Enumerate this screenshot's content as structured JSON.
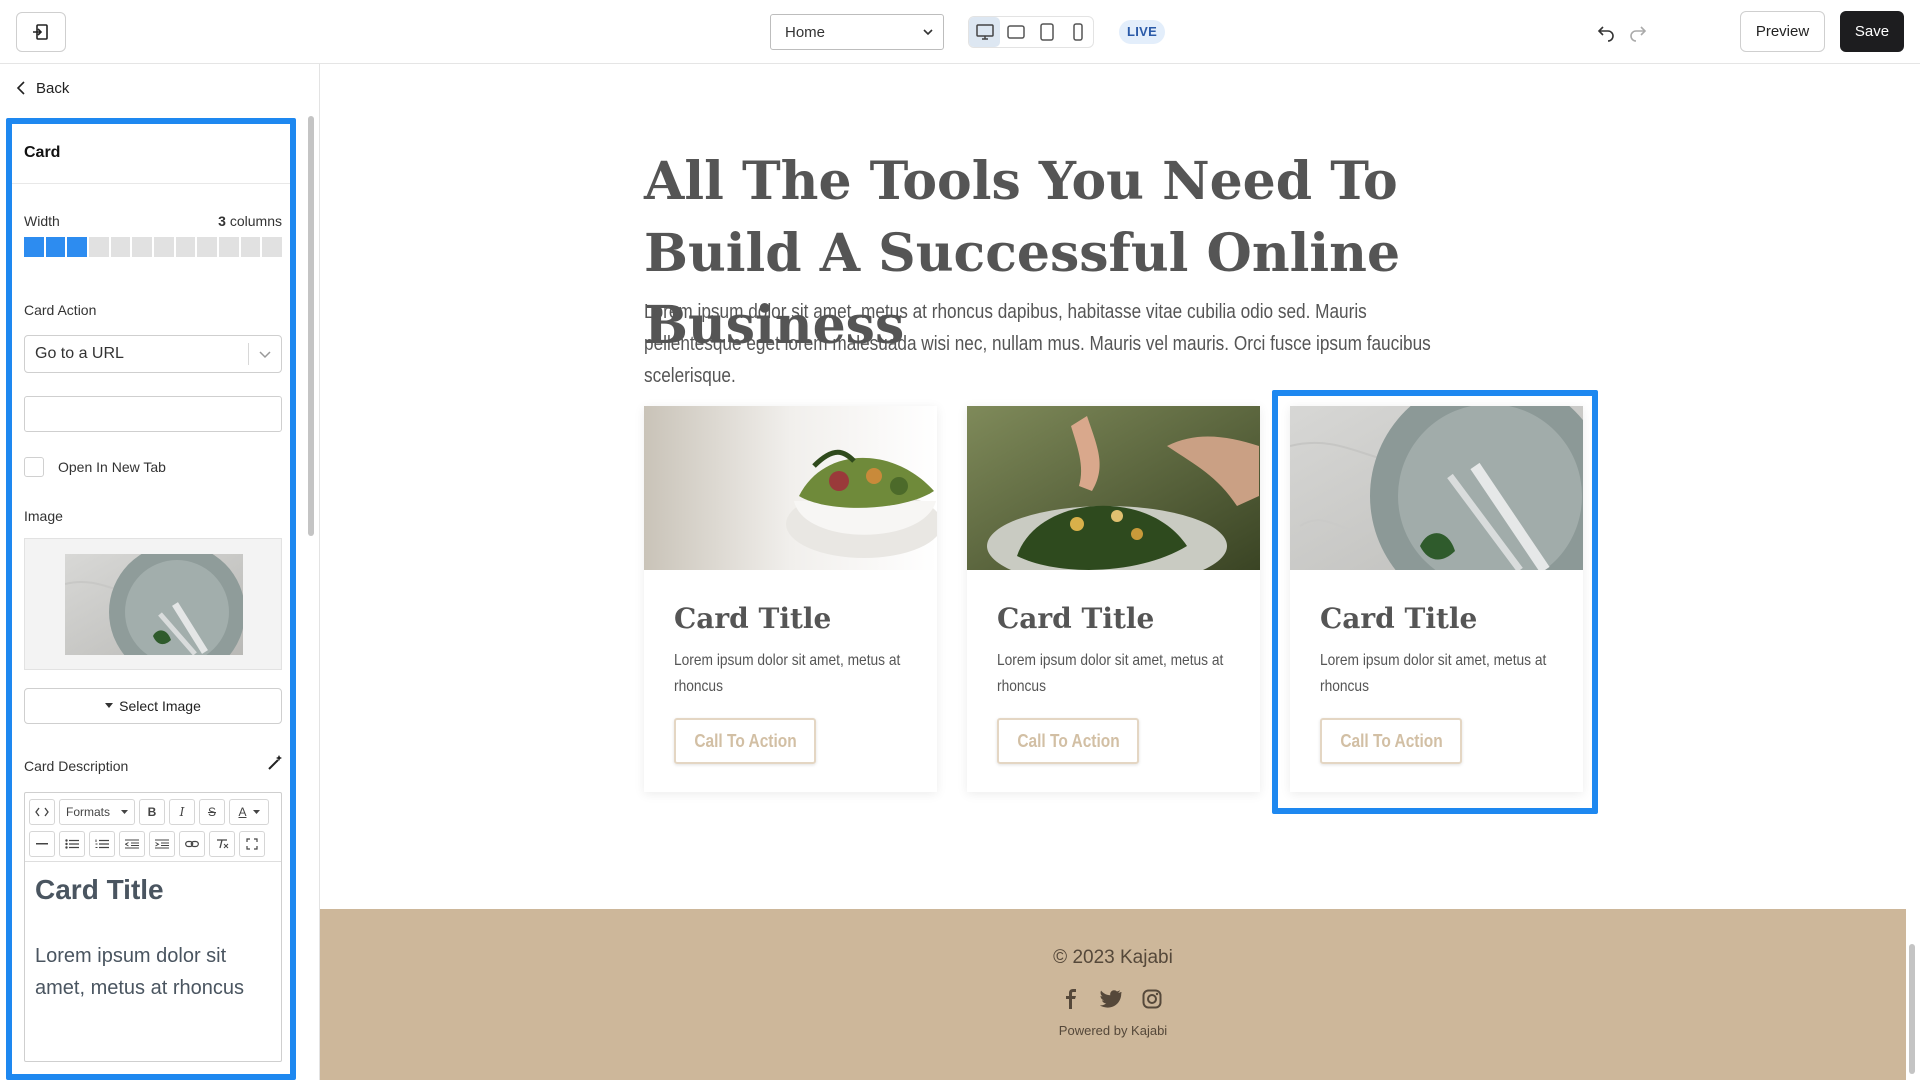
{
  "topbar": {
    "page_select_value": "Home",
    "live_badge": "LIVE",
    "preview_label": "Preview",
    "save_label": "Save"
  },
  "sidebar": {
    "back_label": "Back",
    "panel_title": "Card",
    "width_label": "Width",
    "width_value_number": "3",
    "width_value_unit": "columns",
    "width_columns_selected": 3,
    "width_columns_total": 12,
    "card_action_label": "Card Action",
    "card_action_value": "Go to a URL",
    "url_value": "",
    "open_new_tab_label": "Open In New Tab",
    "open_new_tab_checked": false,
    "image_label": "Image",
    "select_image_label": "Select Image",
    "card_description_label": "Card Description",
    "editor": {
      "formats_label": "Formats",
      "title": "Card Title",
      "description": "Lorem ipsum dolor sit amet, metus at rhoncus"
    }
  },
  "canvas": {
    "hero_title": "All The Tools You Need To Build A Successful Online Business",
    "hero_subtitle": "Lorem ipsum dolor sit amet, metus at rhoncus dapibus, habitasse vitae cubilia odio sed. Mauris pellentesque eget lorem malesuada wisi nec, nullam mus. Mauris vel mauris. Orci fusce ipsum faucibus scelerisque.",
    "cards": [
      {
        "title": "Card Title",
        "description": "Lorem ipsum dolor sit amet, metus at rhoncus",
        "cta": "Call To Action",
        "image": "salad-bowl"
      },
      {
        "title": "Card Title",
        "description": "Lorem ipsum dolor sit amet, metus at rhoncus",
        "cta": "Call To Action",
        "image": "hands-garnishing-plate"
      },
      {
        "title": "Card Title",
        "description": "Lorem ipsum dolor sit amet, metus at rhoncus",
        "cta": "Call To Action",
        "image": "plate-fork-knife"
      }
    ],
    "footer": {
      "copyright": "© 2023 Kajabi",
      "powered_by": "Powered by Kajabi",
      "social_icons": [
        "facebook-icon",
        "twitter-icon",
        "instagram-icon"
      ]
    }
  },
  "colors": {
    "selection_blue": "#1e88f0",
    "footer_bg": "#cdb79a",
    "cta_border": "#e4d6c3",
    "save_bg": "#1d1d1f"
  }
}
